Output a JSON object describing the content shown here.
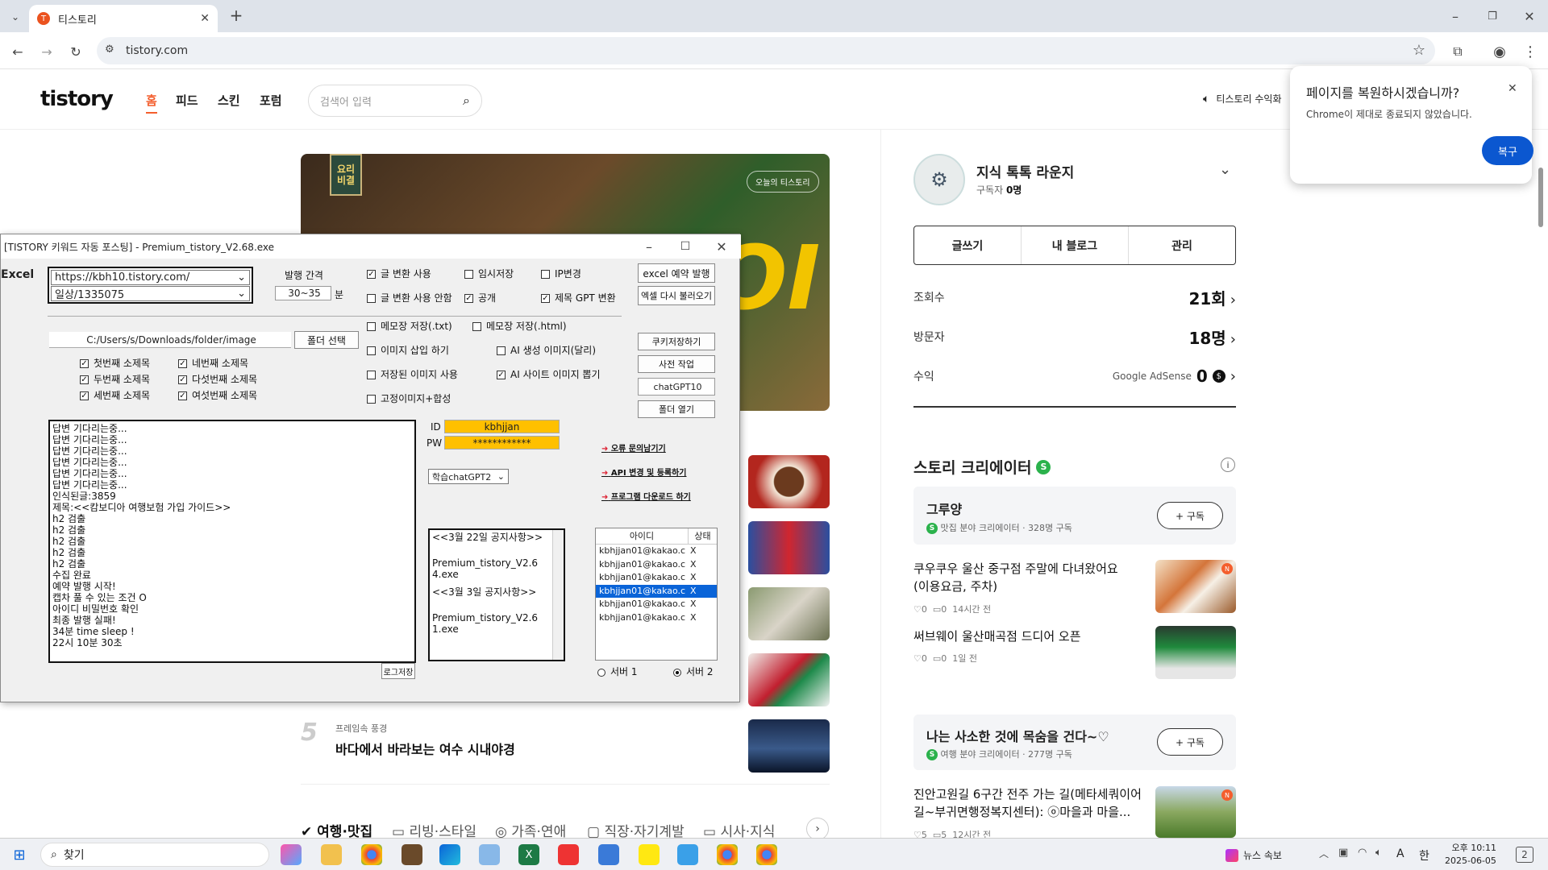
{
  "browser": {
    "tab_title": "티스토리",
    "tab_favicon": "T",
    "url": "tistory.com",
    "new_tab_symbol": "+"
  },
  "restore_popup": {
    "title": "페이지를 복원하시겠습니까?",
    "message": "Chrome이 제대로 종료되지 않았습니다.",
    "button": "복구"
  },
  "tistory": {
    "logo": "tistory",
    "nav": [
      "홈",
      "피드",
      "스킨",
      "포럼"
    ],
    "search_placeholder": "검색어 입력",
    "notice": "티스토리 수익화",
    "hero_badge": "오늘의 티스토리",
    "hero_sign": "요리비결",
    "hero_letters": "OI",
    "list_item5": {
      "number": "5",
      "category": "프레임속 풍경",
      "title": "바다에서 바라보는 여수 시내야경"
    },
    "categories": [
      "여행·맛집",
      "리빙·스타일",
      "가족·연애",
      "직장·자기계발",
      "시사·지식"
    ]
  },
  "blog_card": {
    "name": "지식 톡톡 라운지",
    "subscribers_label": "구독자",
    "subscribers": "0명",
    "buttons": [
      "글쓰기",
      "내 블로그",
      "관리"
    ],
    "stats": [
      {
        "label": "조회수",
        "value": "21회"
      },
      {
        "label": "방문자",
        "value": "18명"
      },
      {
        "label": "수익",
        "sublabel": "Google AdSense",
        "value": "0"
      }
    ],
    "currency_symbol": "$"
  },
  "story_creator": {
    "heading": "스토리 크리에이터",
    "badge": "S",
    "creators": [
      {
        "name": "그루양",
        "meta": "맛집 분야 크리에이터 · 328명 구독",
        "button": "+ 구독"
      },
      {
        "name": "나는 사소한 것에 목숨을 건다~♡",
        "meta": "여행 분야 크리에이터 · 277명 구독",
        "button": "+ 구독"
      }
    ],
    "posts": [
      {
        "title": "쿠우쿠우 울산 중구점 주말에 다녀왔어요 (이용요금, 주차)",
        "likes": "0",
        "comments": "0",
        "time": "14시간 전",
        "new": true
      },
      {
        "title": "써브웨이 울산매곡점 드디어 오픈",
        "likes": "0",
        "comments": "0",
        "time": "1일 전",
        "new": false
      },
      {
        "title": "진안고원길 6구간 전주 가는 길(메타세쿼이어길~부귀면행정복지센터): ⓞ마을과 마을...",
        "likes": "5",
        "comments": "5",
        "time": "12시간 전",
        "new": true
      }
    ]
  },
  "app": {
    "title": "[TISTORY 키워드 자동 포스팅] - Premium_tistory_V2.68.exe",
    "excel_label": "Excel",
    "url_combo": "https://kbh10.tistory.com/",
    "category_combo": "일상/1335075",
    "interval_label": "발행 간격",
    "interval_value": "30~35",
    "interval_unit": "분",
    "options_top": [
      {
        "label": "글 변환 사용",
        "checked": true
      },
      {
        "label": "임시저장",
        "checked": false
      },
      {
        "label": "IP변경",
        "checked": false
      },
      {
        "label": "글 변환 사용 안함",
        "checked": false
      },
      {
        "label": "공개",
        "checked": true
      },
      {
        "label": "제목 GPT 변환",
        "checked": true
      }
    ],
    "excel_buttons": [
      "excel 예약 발행",
      "엑셀 다시 불러오기"
    ],
    "memo_options": [
      {
        "label": "메모장 저장(.txt)",
        "checked": false
      },
      {
        "label": "메모장 저장(.html)",
        "checked": false
      }
    ],
    "image_options": [
      {
        "label": "이미지 삽입 하기",
        "checked": false
      },
      {
        "label": "AI 생성 이미지(달리)",
        "checked": false
      },
      {
        "label": "저장된 이미지 사용",
        "checked": false
      },
      {
        "label": "AI 사이트 이미지 뽑기",
        "checked": true
      },
      {
        "label": "고정이미지+합성",
        "checked": false
      }
    ],
    "folder_path": "C:/Users/s/Downloads/folder/image",
    "folder_button": "폴더 선택",
    "subtitles": [
      {
        "label": "첫번째 소제목",
        "checked": true
      },
      {
        "label": "네번째 소제목",
        "checked": true
      },
      {
        "label": "두번째 소제목",
        "checked": true
      },
      {
        "label": "다섯번째 소제목",
        "checked": true
      },
      {
        "label": "세번째 소제목",
        "checked": true
      },
      {
        "label": "여섯번째 소제목",
        "checked": true
      }
    ],
    "side_buttons": [
      "쿠키저장하기",
      "사전 작업",
      "chatGPT10",
      "폴더 열기"
    ],
    "log_lines": [
      "답변 기다리는중...",
      "답변 기다리는중...",
      "답변 기다리는중...",
      "답변 기다리는중...",
      "답변 기다리는중...",
      "답변 기다리는중...",
      "인식된글:3859",
      "제목:<<캄보디아 여행보험 가입 가이드>>",
      "h2 검출",
      "h2 검출",
      "h2 검출",
      "h2 검출",
      "h2 검출",
      "수집 완료",
      "예약 발행 시작!",
      "캡차 풀 수 있는 조건 O",
      "아이디 비밀번호 확인",
      "최종 발행 실패!",
      "34분 time sleep !",
      "22시 10분 30초"
    ],
    "log_save_button": "로그저장",
    "id_label": "ID",
    "id_value": "kbhjjan",
    "pw_label": "PW",
    "pw_value": "************",
    "model_select": "학습chatGPT2",
    "links": [
      "오류 문의남기기",
      "API 변경 및 등록하기",
      "프로그램 다운로드 하기"
    ],
    "notices": [
      "<<3월 22일 공지사항>>",
      "Premium_tistory_V2.64.exe",
      "<<3월 3일 공지사항>>",
      "Premium_tistory_V2.61.exe"
    ],
    "account_headers": [
      "아이디",
      "상태"
    ],
    "accounts": [
      {
        "id": "kbhjjan01@kakao.c",
        "status": "X",
        "selected": false
      },
      {
        "id": "kbhjjan01@kakao.c",
        "status": "X",
        "selected": false
      },
      {
        "id": "kbhjjan01@kakao.c",
        "status": "X",
        "selected": false
      },
      {
        "id": "kbhjjan01@kakao.c",
        "status": "X",
        "selected": true
      },
      {
        "id": "kbhjjan01@kakao.c",
        "status": "X",
        "selected": false
      },
      {
        "id": "kbhjjan01@kakao.c",
        "status": "X",
        "selected": false
      }
    ],
    "servers": [
      {
        "label": "서버 1",
        "selected": false
      },
      {
        "label": "서버 2",
        "selected": true
      }
    ]
  },
  "taskbar": {
    "search_label": "찾기",
    "news": "뉴스 속보",
    "ime": "A",
    "lang": "한",
    "time": "오후 10:11",
    "date": "2025-06-05",
    "notification_count": "2"
  }
}
